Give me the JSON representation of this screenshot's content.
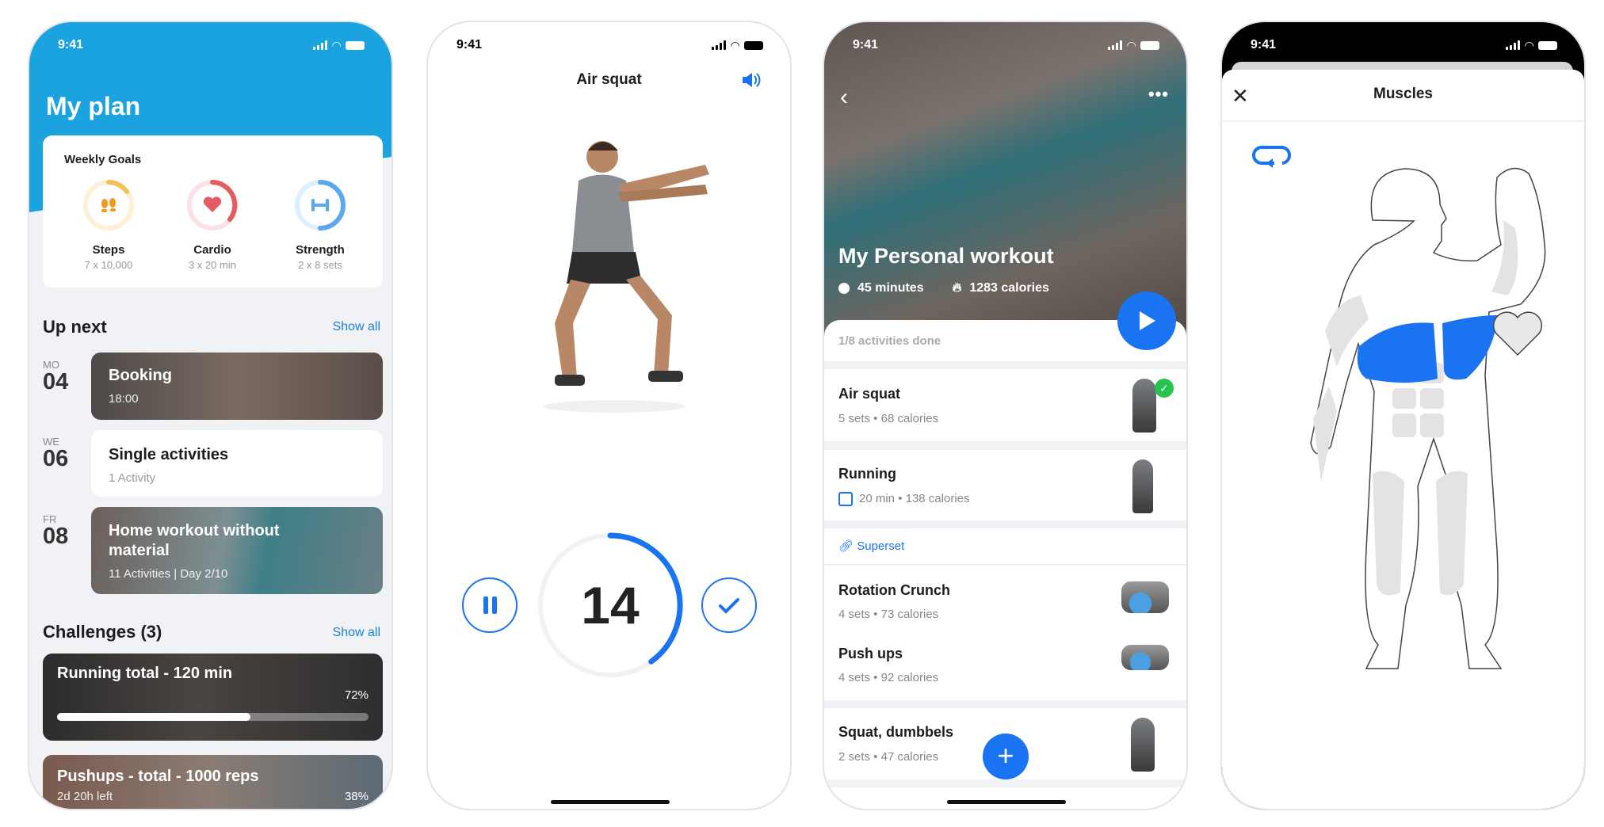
{
  "status_time": "9:41",
  "colors": {
    "primary_blue": "#1a73f0",
    "header_blue": "#1aa3df",
    "steps": "#f5c05a",
    "cardio": "#e55b62",
    "strength": "#5aa8ef",
    "done_green": "#28c24f"
  },
  "plan": {
    "title": "My plan",
    "weekly_goals": {
      "title": "Weekly Goals",
      "goals": [
        {
          "name": "Steps",
          "target": "7 x 10,000",
          "icon": "footsteps-icon"
        },
        {
          "name": "Cardio",
          "target": "3 x 20 min",
          "icon": "heart-icon"
        },
        {
          "name": "Strength",
          "target": "2 x 8 sets",
          "icon": "dumbbell-icon"
        }
      ]
    },
    "up_next": {
      "title": "Up next",
      "show_all": "Show all",
      "items": [
        {
          "weekday": "MO",
          "day": "04",
          "title": "Booking",
          "subtitle": "18:00"
        },
        {
          "weekday": "WE",
          "day": "06",
          "title": "Single activities",
          "subtitle": "1 Activity"
        },
        {
          "weekday": "FR",
          "day": "08",
          "title": "Home workout without material",
          "subtitle": "11 Activities | Day 2/10"
        }
      ]
    },
    "challenges": {
      "title": "Challenges (3)",
      "show_all": "Show all",
      "items": [
        {
          "title": "Running total - 120 min",
          "percent_label": "72%",
          "progress": 0.62
        },
        {
          "title": "Pushups - total - 1000 reps",
          "subtitle": "2d 20h left",
          "percent_label": "38%"
        }
      ]
    }
  },
  "exercise": {
    "title": "Air squat",
    "counter": "14",
    "timer_progress": 0.4
  },
  "workout": {
    "title": "My Personal workout",
    "duration": "45 minutes",
    "calories": "1283 calories",
    "progress_text": "1/8 activities done",
    "superset_label": "Superset",
    "exercises": [
      {
        "name": "Air squat",
        "detail1": "5 sets",
        "detail2": "68 calories",
        "done": true
      },
      {
        "name": "Running",
        "detail1": "20 min",
        "detail2": "138 calories"
      },
      {
        "name": "Rotation Crunch",
        "detail1": "4 sets",
        "detail2": "73 calories"
      },
      {
        "name": "Push ups",
        "detail1": "4 sets",
        "detail2": "92 calories"
      },
      {
        "name": "Squat, dumbbels",
        "detail1": "2 sets",
        "detail2": "47 calories"
      }
    ]
  },
  "muscles": {
    "title": "Muscles",
    "highlighted": "chest"
  }
}
